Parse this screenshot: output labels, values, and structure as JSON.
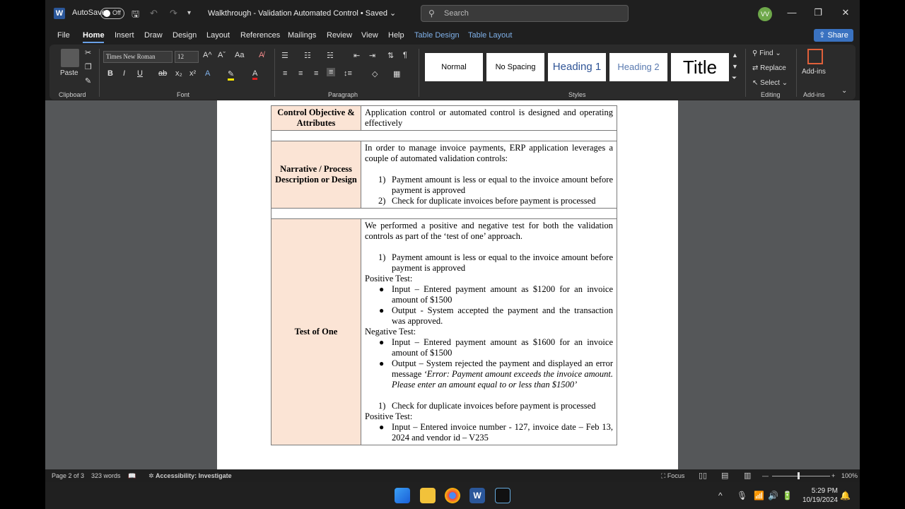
{
  "titlebar": {
    "app_initial": "W",
    "autosave_label": "AutoSave",
    "autosave_state": "Off",
    "doc_title": "Walkthrough - Validation Automated Control • Saved ⌄",
    "search_placeholder": "Search",
    "avatar_initials": "VV"
  },
  "menu": {
    "tabs": [
      "File",
      "Home",
      "Insert",
      "Draw",
      "Design",
      "Layout",
      "References",
      "Mailings",
      "Review",
      "View",
      "Help",
      "Table Design",
      "Table Layout"
    ],
    "share_label": "Share"
  },
  "ribbon": {
    "clipboard": {
      "paste_label": "Paste",
      "group_label": "Clipboard"
    },
    "font": {
      "font_name": "Times New Roman",
      "font_size": "12",
      "group_label": "Font"
    },
    "paragraph": {
      "group_label": "Paragraph"
    },
    "styles": {
      "group_label": "Styles",
      "items": [
        "Normal",
        "No Spacing",
        "Heading 1",
        "Heading 2",
        "Title"
      ]
    },
    "editing": {
      "find": "Find",
      "replace": "Replace",
      "select": "Select",
      "group_label": "Editing"
    },
    "addins": {
      "label": "Add-ins",
      "group_label": "Add-ins"
    }
  },
  "document": {
    "row1": {
      "label": "Control Objective & Attributes",
      "value": "Application control or automated control is designed and operating effectively"
    },
    "row2": {
      "label": "Narrative / Process Description or Design",
      "intro": "In order to manage invoice payments, ERP application leverages a couple of automated validation controls:",
      "items": [
        {
          "num": "1)",
          "text": "Payment amount is less or equal to the invoice amount before payment is approved"
        },
        {
          "num": "2)",
          "text": "Check for duplicate invoices before payment is processed"
        }
      ]
    },
    "row3": {
      "label": "Test of One",
      "intro": "We performed a positive and negative test for both the validation controls as part of the ‘test of one’ approach.",
      "item1_num": "1)",
      "item1_text": "Payment amount is less or equal to the invoice amount before payment is approved",
      "positive_heading": "Positive Test:",
      "positive_items": [
        "Input – Entered payment amount as $1200 for an invoice amount of $1500",
        "Output - System accepted the payment and the transaction was approved."
      ],
      "negative_heading": "Negative Test:",
      "negative_item1": "Input – Entered payment amount as $1600 for an invoice amount of $1500",
      "negative_item2_prefix": "Output – System rejected the payment and displayed an error message ",
      "negative_item2_italic": "‘Error: Payment amount exceeds the invoice amount. Please enter an amount equal to or less than $1500’",
      "item2_num": "1)",
      "item2_text": "Check for duplicate invoices before payment is processed",
      "positive_heading_2": "Positive Test:",
      "positive2_item": "Input – Entered invoice number - 127, invoice date – Feb 13, 2024 and vendor id – V235"
    }
  },
  "statusbar": {
    "page": "Page 2 of 3",
    "words": "323 words",
    "accessibility": "Accessibility: Investigate",
    "focus": "Focus",
    "zoom": "100%"
  },
  "taskbar": {
    "time": "5:29 PM",
    "date": "10/19/2024"
  }
}
